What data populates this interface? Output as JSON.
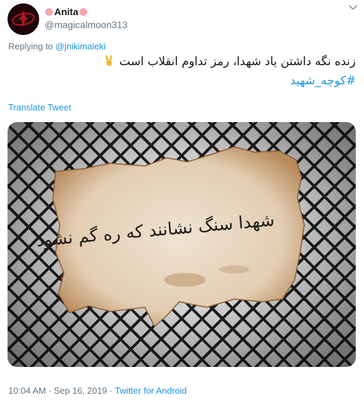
{
  "user": {
    "display_name": "Anita",
    "name_emoji": "cherry-blossom",
    "handle": "@magicalmoon313"
  },
  "reply": {
    "prefix": "Replying to",
    "to": "@jnikimaleki"
  },
  "tweet": {
    "text": "زنده نگه داشتن یاد شهدا، رمز تداوم انقلاب است",
    "emoji": "victory-hand",
    "hashtag": "#کوچه_شهید"
  },
  "translate_label": "Translate Tweet",
  "media": {
    "calligraphy": "شهدا سنگ نشانند که ره گم نشود"
  },
  "meta": {
    "time": "10:04 AM",
    "separator1": " · ",
    "date": "Sep 16, 2019",
    "separator2": " · ",
    "source": "Twitter for Android"
  },
  "colors": {
    "link": "#1b95e0",
    "muted": "#657786",
    "text": "#14171a"
  }
}
